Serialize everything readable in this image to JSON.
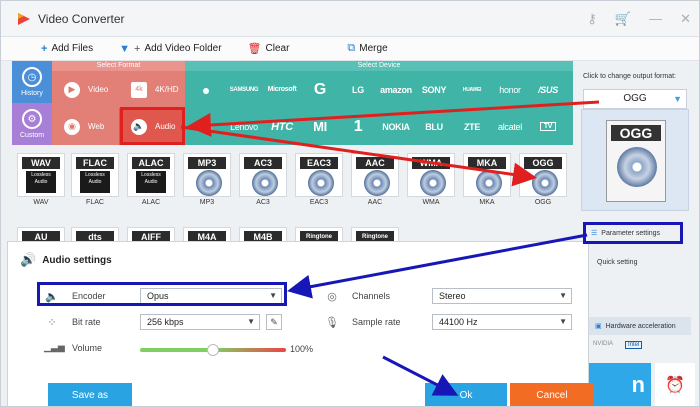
{
  "window": {
    "title": "Video Converter"
  },
  "toolbar": {
    "add_files": "Add Files",
    "add_video_folder": "Add Video Folder",
    "clear": "Clear",
    "merge": "Merge"
  },
  "leftnav": {
    "history": "History",
    "custom": "Custom"
  },
  "format_panel": {
    "header": "Select Format",
    "items": [
      {
        "label": "Video",
        "icon": "play-icon"
      },
      {
        "label": "4K/HD",
        "icon": "4k-icon"
      },
      {
        "label": "Web",
        "icon": "chrome-icon"
      },
      {
        "label": "Audio",
        "icon": "speaker-icon"
      }
    ]
  },
  "device_panel": {
    "header": "Select Device",
    "row1": [
      "",
      "SAMSUNG",
      "Microsoft",
      "G",
      "LG",
      "amazon",
      "SONY",
      "HUAWEI",
      "honor",
      "/SUS"
    ],
    "row2": [
      "M",
      "Lenovo",
      "HTC",
      "MI",
      "1",
      "NOKIA",
      "BLU",
      "ZTE",
      "alcatel",
      "TV"
    ]
  },
  "audio_formats": {
    "row1": [
      {
        "label": "WAV",
        "badge": "WAV",
        "sub": "Lossless Audio"
      },
      {
        "label": "FLAC",
        "badge": "FLAC",
        "sub": "Lossless Audio"
      },
      {
        "label": "ALAC",
        "badge": "ALAC",
        "sub": "Lossless Audio"
      },
      {
        "label": "MP3",
        "badge": "MP3",
        "sub": ""
      },
      {
        "label": "AC3",
        "badge": "AC3",
        "sub": ""
      },
      {
        "label": "EAC3",
        "badge": "EAC3",
        "sub": ""
      },
      {
        "label": "AAC",
        "badge": "AAC",
        "sub": ""
      },
      {
        "label": "WMA",
        "badge": "WMA",
        "sub": ""
      },
      {
        "label": "MKA",
        "badge": "MKA",
        "sub": ""
      },
      {
        "label": "OGG",
        "badge": "OGG",
        "sub": ""
      }
    ],
    "row2": [
      "AU",
      "dts",
      "AIFF",
      "M4A",
      "M4B",
      "Ringtone",
      "Ringtone"
    ]
  },
  "right_panel": {
    "click_label": "Click to change output format:",
    "output_format": "OGG",
    "badge": "OGG",
    "param_settings": "Parameter settings",
    "quick_setting": "Quick setting",
    "hw_accel": "Hardware acceleration",
    "gpu": [
      "NVIDIA",
      "Intel"
    ],
    "run_letter": "n"
  },
  "dialog": {
    "title": "Audio settings",
    "encoder_label": "Encoder",
    "encoder_value": "Opus",
    "bitrate_label": "Bit rate",
    "bitrate_value": "256 kbps",
    "volume_label": "Volume",
    "volume_value": "100%",
    "volume_level": 0.5,
    "channels_label": "Channels",
    "channels_value": "Stereo",
    "samplerate_label": "Sample rate",
    "samplerate_value": "44100 Hz",
    "save_as": "Save as",
    "ok": "Ok",
    "cancel": "Cancel"
  },
  "colors": {
    "accent_blue": "#2aa3e3",
    "format_red": "#e27f77",
    "device_teal": "#3fb4a7",
    "cancel_orange": "#f36c23",
    "annotation_red": "#e0201f",
    "annotation_blue": "#1717b8"
  }
}
